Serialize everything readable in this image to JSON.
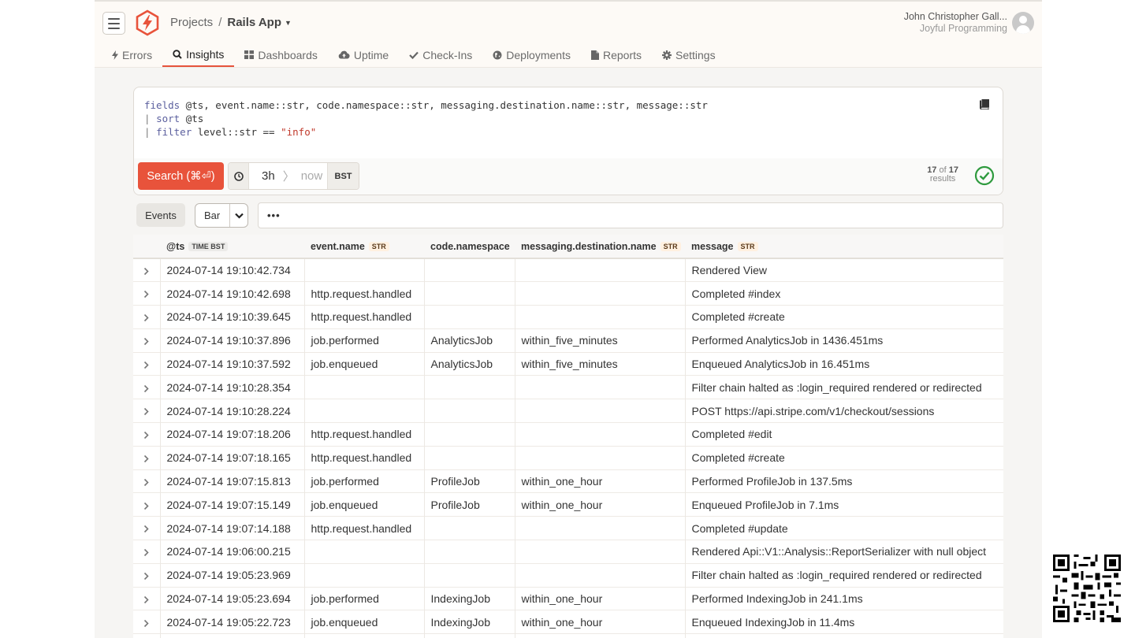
{
  "header": {
    "breadcrumb_projects": "Projects",
    "breadcrumb_sep": "/",
    "app_name": "Rails App",
    "user_name": "John Christopher Gall...",
    "org_name": "Joyful Programming"
  },
  "nav": {
    "tabs": [
      {
        "label": "Errors",
        "icon": "bolt-icon"
      },
      {
        "label": "Insights",
        "icon": "search-icon"
      },
      {
        "label": "Dashboards",
        "icon": "grid-icon"
      },
      {
        "label": "Uptime",
        "icon": "cloud-upload-icon"
      },
      {
        "label": "Check-Ins",
        "icon": "check-icon"
      },
      {
        "label": "Deployments",
        "icon": "globe-icon"
      },
      {
        "label": "Reports",
        "icon": "file-icon"
      },
      {
        "label": "Settings",
        "icon": "gear-icon"
      }
    ],
    "active": "Insights"
  },
  "query": {
    "line1_kw": "fields",
    "line1_rest": " @ts, event.name::str, code.namespace::str, messaging.destination.name::str, message::str",
    "line2_pipe": "| ",
    "line2_kw": "sort",
    "line2_rest": " @ts",
    "line3_pipe": "| ",
    "line3_kw": "filter",
    "line3_rest": " level::str == ",
    "line3_str": "\"info\"",
    "search_label": "Search (⌘⏎)",
    "range_from": "3h",
    "range_to": "now",
    "timezone": "BST",
    "result_shown": "17",
    "result_of": "of",
    "result_total": "17",
    "result_label": "results"
  },
  "controls": {
    "events_label": "Events",
    "viz_value": "Bar",
    "filter_value": "•••"
  },
  "colors": {
    "accent": "#e8533b",
    "ok": "#2e9a3e"
  },
  "table": {
    "columns": [
      {
        "label": "@ts",
        "badge": "TIME BST",
        "badge_type": "time"
      },
      {
        "label": "event.name",
        "badge": "STR",
        "badge_type": "str"
      },
      {
        "label": "code.namespace",
        "badge": "",
        "badge_type": ""
      },
      {
        "label": "messaging.destination.name",
        "badge": "STR",
        "badge_type": "str"
      },
      {
        "label": "message",
        "badge": "STR",
        "badge_type": "str"
      }
    ],
    "rows": [
      [
        "2024-07-14 19:10:42.734",
        "",
        "",
        "",
        "Rendered View"
      ],
      [
        "2024-07-14 19:10:42.698",
        "http.request.handled",
        "",
        "",
        "Completed #index"
      ],
      [
        "2024-07-14 19:10:39.645",
        "http.request.handled",
        "",
        "",
        "Completed #create"
      ],
      [
        "2024-07-14 19:10:37.896",
        "job.performed",
        "AnalyticsJob",
        "within_five_minutes",
        "Performed AnalyticsJob in 1436.451ms"
      ],
      [
        "2024-07-14 19:10:37.592",
        "job.enqueued",
        "AnalyticsJob",
        "within_five_minutes",
        "Enqueued AnalyticsJob in 16.451ms"
      ],
      [
        "2024-07-14 19:10:28.354",
        "",
        "",
        "",
        "Filter chain halted as :login_required rendered or redirected"
      ],
      [
        "2024-07-14 19:10:28.224",
        "",
        "",
        "",
        "POST https://api.stripe.com/v1/checkout/sessions"
      ],
      [
        "2024-07-14 19:07:18.206",
        "http.request.handled",
        "",
        "",
        "Completed #edit"
      ],
      [
        "2024-07-14 19:07:18.165",
        "http.request.handled",
        "",
        "",
        "Completed #create"
      ],
      [
        "2024-07-14 19:07:15.813",
        "job.performed",
        "ProfileJob",
        "within_one_hour",
        "Performed ProfileJob in 137.5ms"
      ],
      [
        "2024-07-14 19:07:15.149",
        "job.enqueued",
        "ProfileJob",
        "within_one_hour",
        "Enqueued ProfileJob in 7.1ms"
      ],
      [
        "2024-07-14 19:07:14.188",
        "http.request.handled",
        "",
        "",
        "Completed #update"
      ],
      [
        "2024-07-14 19:06:00.215",
        "",
        "",
        "",
        "Rendered Api::V1::Analysis::ReportSerializer with null object"
      ],
      [
        "2024-07-14 19:05:23.969",
        "",
        "",
        "",
        "Filter chain halted as :login_required rendered or redirected"
      ],
      [
        "2024-07-14 19:05:23.694",
        "job.performed",
        "IndexingJob",
        "within_one_hour",
        "Performed IndexingJob in 241.1ms"
      ],
      [
        "2024-07-14 19:05:22.723",
        "job.enqueued",
        "IndexingJob",
        "within_one_hour",
        "Enqueued IndexingJob in 11.4ms"
      ],
      [
        "",
        "",
        "",
        "",
        ""
      ]
    ]
  }
}
